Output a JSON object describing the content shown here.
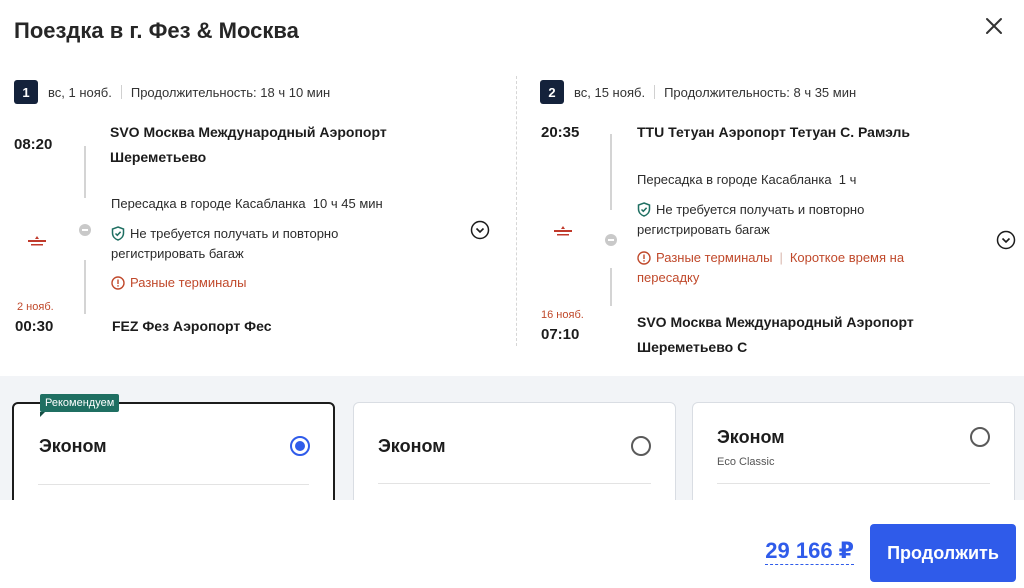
{
  "title": "Поездка в г. Фез & Москва",
  "legs": [
    {
      "num": "1",
      "date": "вс, 1 нояб.",
      "duration": "Продолжительность: 18 ч 10 мин",
      "dep_time": "08:20",
      "dep_airport": "SVO Москва Международный Аэропорт Шереметьево",
      "transfer_city": "Пересадка в городе Касабланка",
      "transfer_time": "10 ч 45 мин",
      "baggage": "Не требуется получать и повторно регистрировать багаж",
      "warning": "Разные терминалы",
      "arr_date": "2 нояб.",
      "arr_time": "00:30",
      "arr_airport": "FEZ Фез Аэропорт Фес"
    },
    {
      "num": "2",
      "date": "вс, 15 нояб.",
      "duration": "Продолжительность: 8 ч 35 мин",
      "dep_time": "20:35",
      "dep_airport": "TTU Тетуан Аэропорт Тетуан С. Рамэль",
      "transfer_city": "Пересадка в городе Касабланка",
      "transfer_time": "1 ч",
      "baggage": "Не требуется получать и повторно регистрировать багаж",
      "warning": "Разные терминалы",
      "warning2": "Короткое время на пересадку",
      "arr_date": "16 нояб.",
      "arr_time": "07:10",
      "arr_airport": "SVO Москва Международный Аэропорт Шереметьево С"
    }
  ],
  "fares": [
    {
      "badge": "Рекомендуем",
      "name": "Эконом",
      "selected": true
    },
    {
      "name": "Эконом",
      "selected": false
    },
    {
      "name": "Эконом",
      "subtitle": "Eco Classic",
      "selected": false
    }
  ],
  "footer": {
    "price": "29 166 ₽",
    "continue_label": "Продолжить"
  },
  "colors": {
    "accent": "#2f5bea",
    "warning": "#c0492b",
    "badge": "#1f6f62",
    "dark": "#14223b"
  },
  "icons": {
    "close": "close-icon",
    "expand": "chevron-down-icon",
    "baggage": "shield-check-icon",
    "warning": "alert-circle-icon",
    "airline": "airline-logo"
  }
}
